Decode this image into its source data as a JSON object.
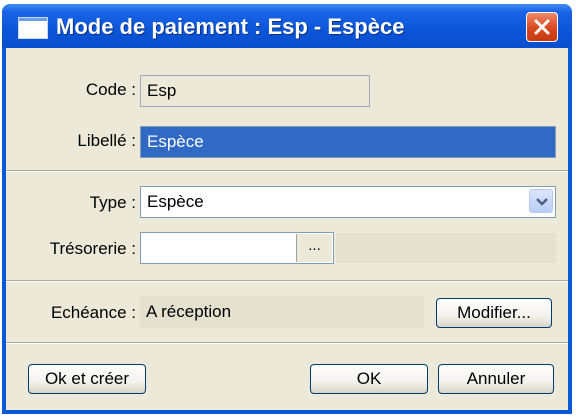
{
  "window": {
    "title": "Mode de paiement : Esp - Espèce"
  },
  "form": {
    "code_label": "Code :",
    "code_value": "Esp",
    "libelle_label": "Libellé :",
    "libelle_value": "Espèce",
    "type_label": "Type :",
    "type_value": "Espèce",
    "tresorerie_label": "Trésorerie :",
    "tresorerie_value": "",
    "tresorerie_browse": "...",
    "echeance_label": "Echéance :",
    "echeance_value": "A réception"
  },
  "buttons": {
    "modifier": "Modifier...",
    "ok_creer": "Ok et créer",
    "ok": "OK",
    "annuler": "Annuler"
  },
  "icons": {
    "title": "window-icon",
    "close": "close-icon",
    "dropdown": "chevron-down-icon"
  },
  "colors": {
    "titlebar": "#0a55d8",
    "close": "#d8481e",
    "selection": "#316ac5",
    "dialog_bg": "#ece9d8"
  }
}
